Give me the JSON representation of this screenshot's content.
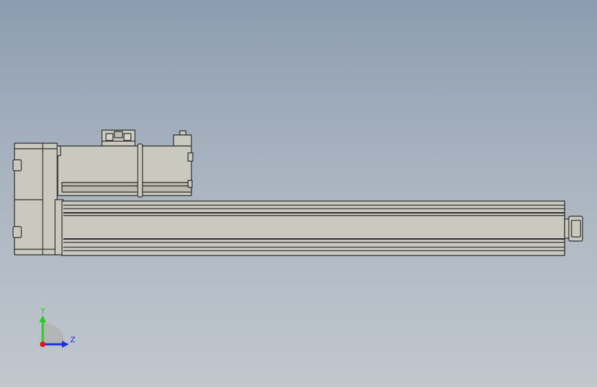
{
  "view": {
    "background_top": "#8c9cb0",
    "background_bottom": "#c1c7cd",
    "part_fill": "#c9c9bf",
    "part_shade": "#b6b6ab",
    "edge_color": "#2a2a2a"
  },
  "triad": {
    "y_label": "Y",
    "z_label": "Z",
    "y_color": "#22cc22",
    "z_color": "#1a2ee0",
    "x_color": "#e01818"
  }
}
